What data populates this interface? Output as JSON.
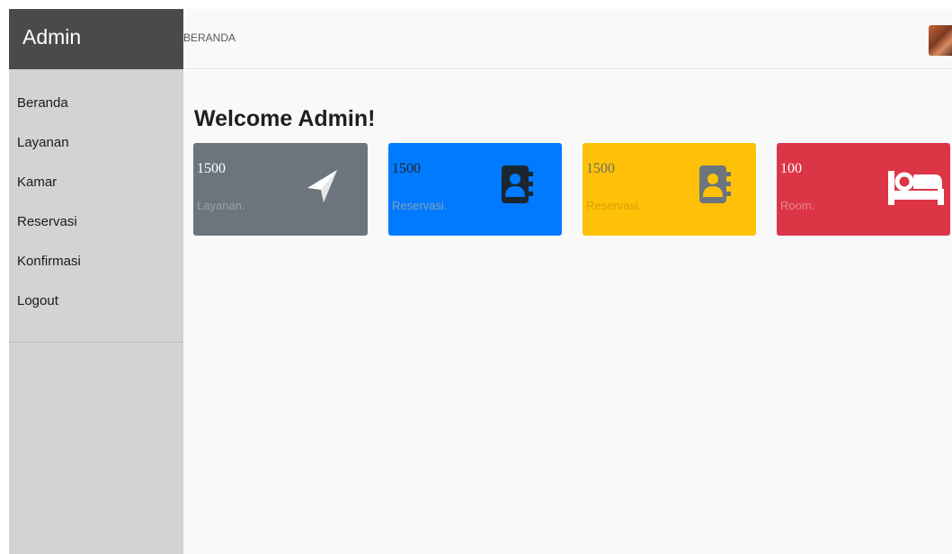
{
  "sidebar": {
    "brand": "Admin",
    "items": [
      {
        "label": "Beranda"
      },
      {
        "label": "Layanan"
      },
      {
        "label": "Kamar"
      },
      {
        "label": "Reservasi"
      },
      {
        "label": "Konfirmasi"
      },
      {
        "label": "Logout"
      }
    ]
  },
  "topbar": {
    "title": "BERANDA"
  },
  "main": {
    "title": "Welcome Admin!",
    "cards": [
      {
        "number": "1500",
        "label": "Layanan.",
        "icon": "paper-plane-icon",
        "bg": "#6c757d",
        "text": "#ffffff",
        "label_color": "#9aa1a7"
      },
      {
        "number": "1500",
        "label": "Reservasi.",
        "icon": "address-book-icon",
        "bg": "#007bff",
        "text": "#212529",
        "label_color": "#8a9fb8"
      },
      {
        "number": "1500",
        "label": "Reservasi.",
        "icon": "address-book-icon",
        "bg": "#ffc107",
        "text": "#6c6c6c",
        "label_color": "#d9a000"
      },
      {
        "number": "100",
        "label": "Room.",
        "icon": "bed-icon",
        "bg": "#dc3545",
        "text": "#ffffff",
        "label_color": "#e8858f"
      }
    ]
  }
}
